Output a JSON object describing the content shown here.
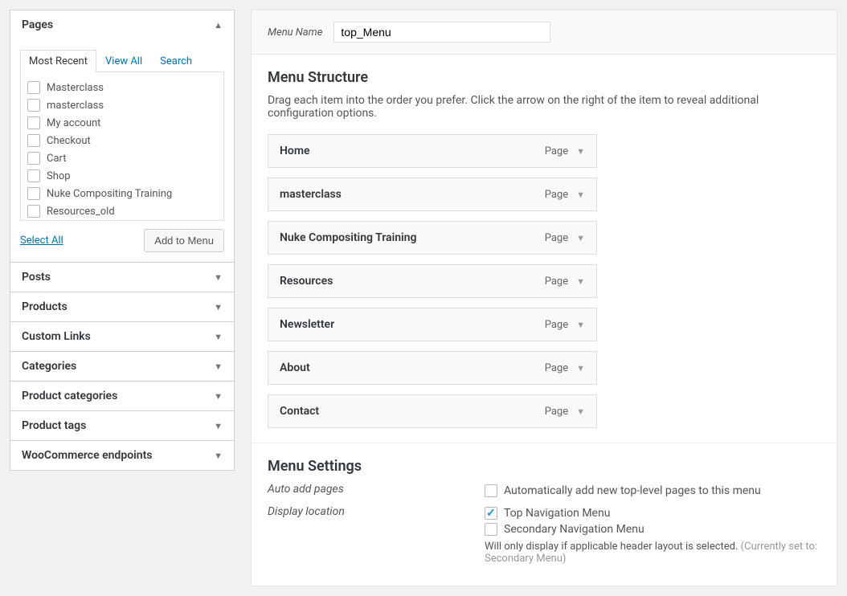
{
  "sidebar": {
    "pages": {
      "title": "Pages",
      "tabs": {
        "recent": "Most Recent",
        "viewall": "View All",
        "search": "Search"
      },
      "items": [
        {
          "label": "Masterclass"
        },
        {
          "label": "masterclass"
        },
        {
          "label": "My account"
        },
        {
          "label": "Checkout"
        },
        {
          "label": "Cart"
        },
        {
          "label": "Shop"
        },
        {
          "label": "Nuke Compositing Training"
        },
        {
          "label": "Resources_old"
        }
      ],
      "select_all": "Select All",
      "add_button": "Add to Menu"
    },
    "collapsed": [
      "Posts",
      "Products",
      "Custom Links",
      "Categories",
      "Product categories",
      "Product tags",
      "WooCommerce endpoints"
    ]
  },
  "menu_name": {
    "label": "Menu Name",
    "value": "top_Menu"
  },
  "structure": {
    "heading": "Menu Structure",
    "hint": "Drag each item into the order you prefer. Click the arrow on the right of the item to reveal additional configuration options.",
    "items": [
      {
        "title": "Home",
        "type": "Page"
      },
      {
        "title": "masterclass",
        "type": "Page"
      },
      {
        "title": "Nuke Compositing Training",
        "type": "Page"
      },
      {
        "title": "Resources",
        "type": "Page"
      },
      {
        "title": "Newsletter",
        "type": "Page"
      },
      {
        "title": "About",
        "type": "Page"
      },
      {
        "title": "Contact",
        "type": "Page"
      }
    ]
  },
  "settings": {
    "heading": "Menu Settings",
    "auto_add_label": "Auto add pages",
    "auto_add_option": "Automatically add new top-level pages to this menu",
    "display_label": "Display location",
    "loc1": "Top Navigation Menu",
    "loc2": "Secondary Navigation Menu",
    "fine_print": "Will only display if applicable header layout is selected. ",
    "fine_print_muted": "(Currently set to: Secondary Menu)"
  }
}
